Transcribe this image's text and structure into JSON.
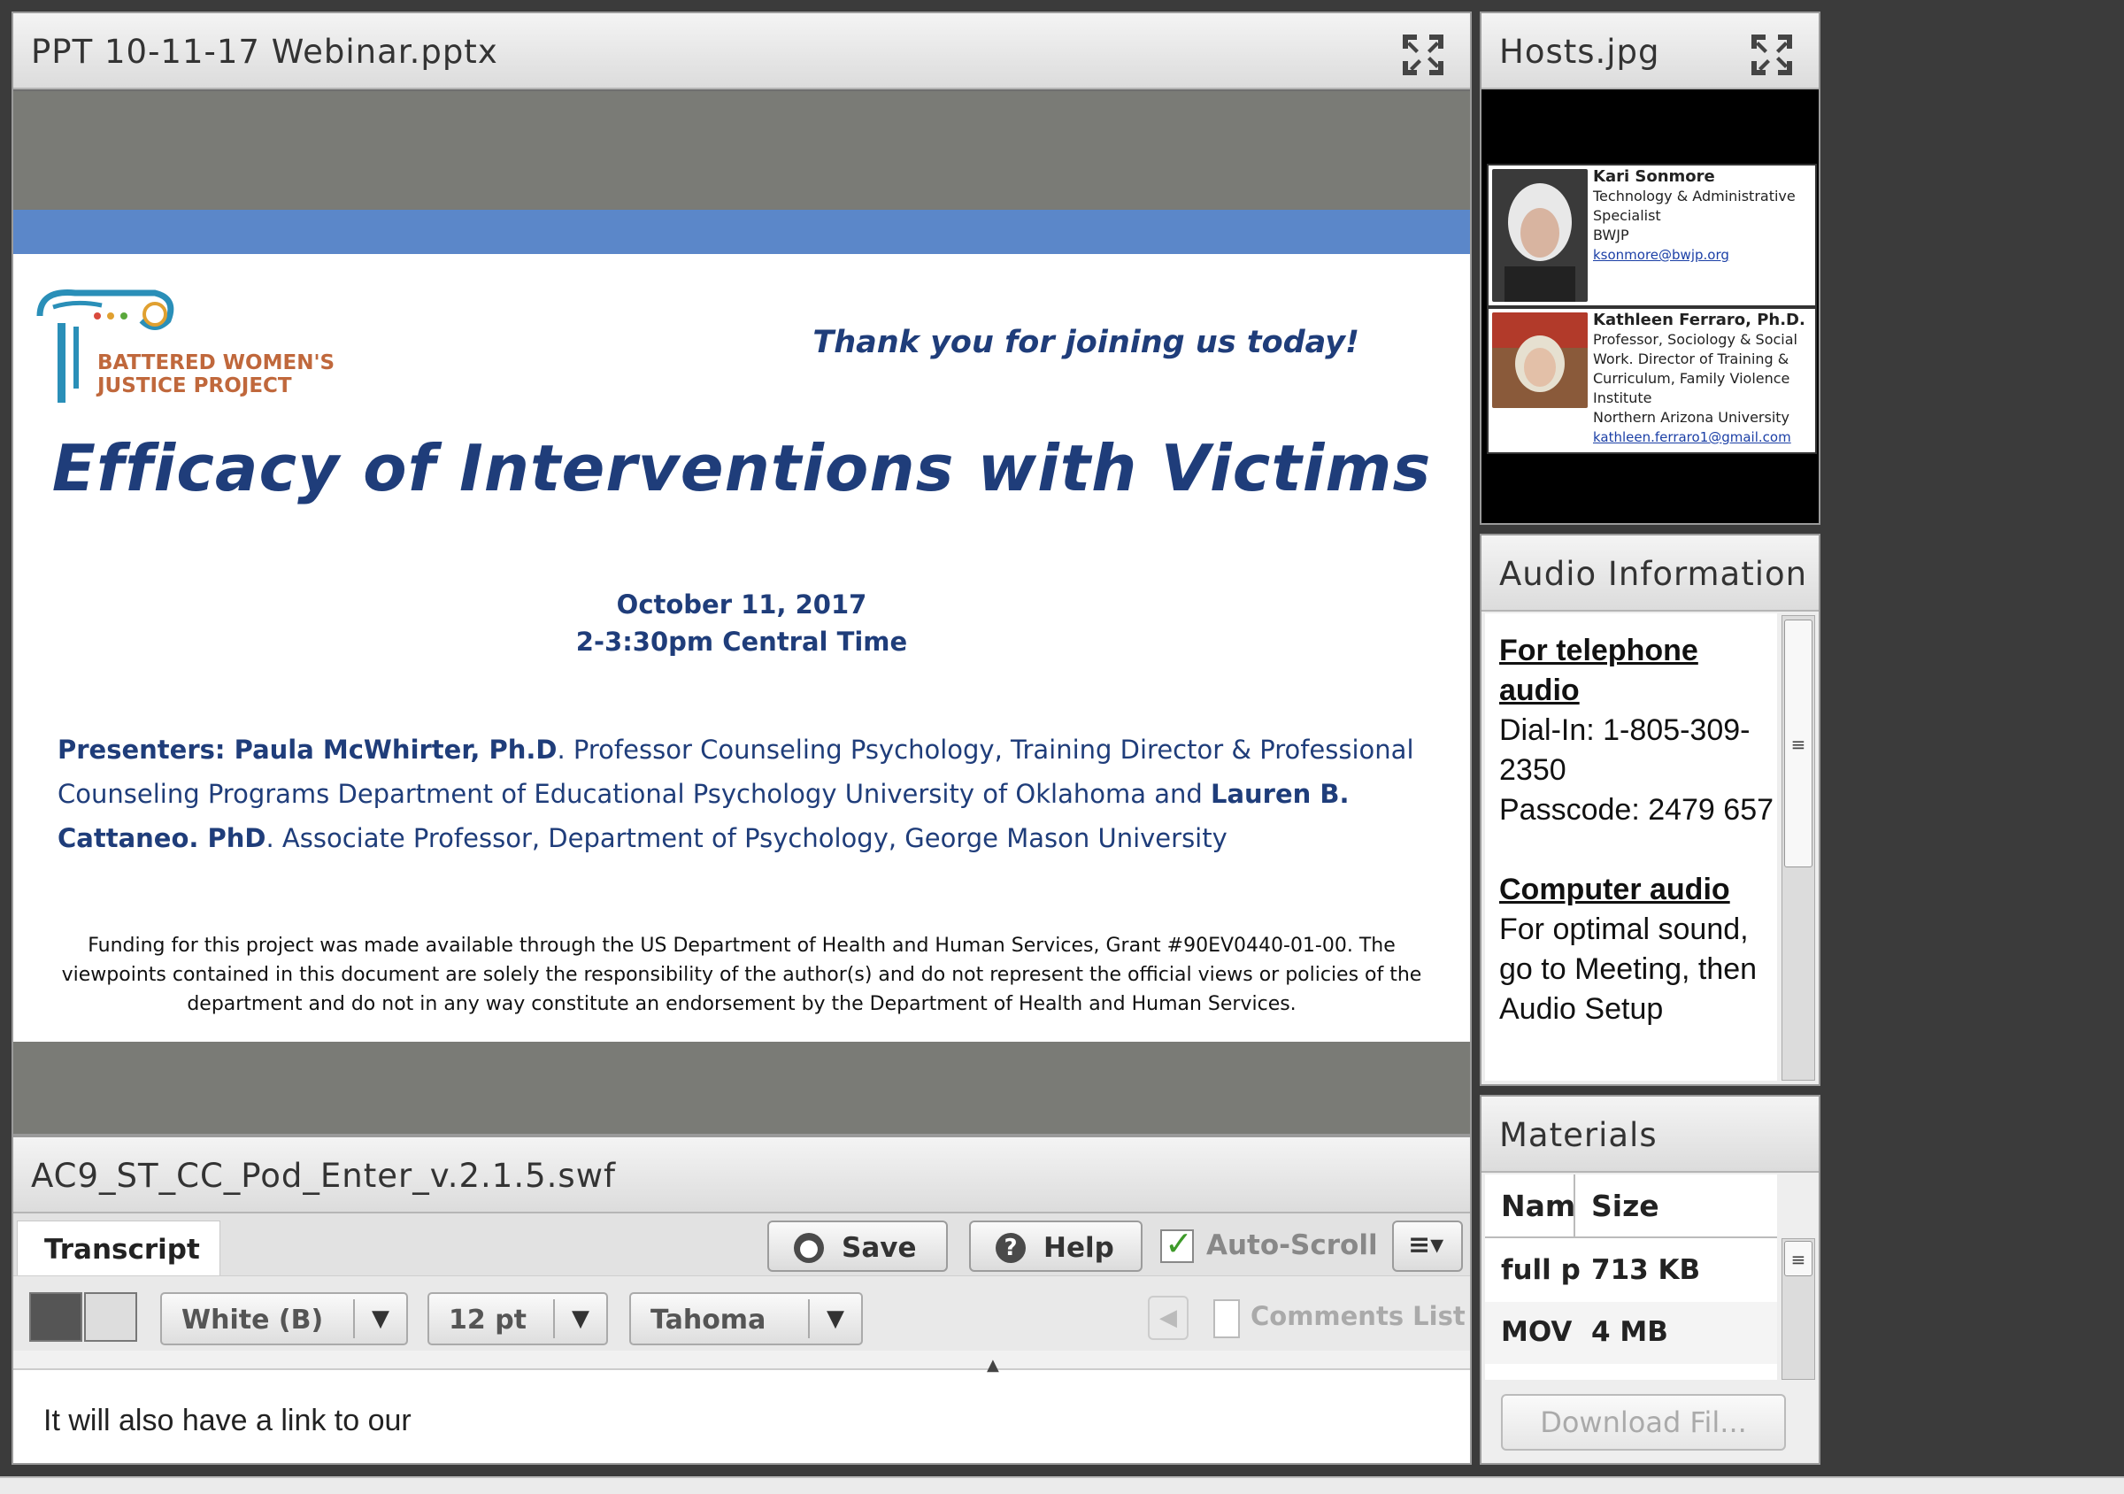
{
  "ppt_pod": {
    "title": "PPT 10-11-17 Webinar.pptx",
    "slide": {
      "logo_line1": "BATTERED WOMEN'S",
      "logo_line2": "JUSTICE PROJECT",
      "thanks": "Thank you for joining us today!",
      "title": "Efficacy of Interventions with Victims",
      "date": "October 11, 2017",
      "time": "2-3:30pm Central Time",
      "presenters_label": "Presenters: Paula McWhirter, Ph.D",
      "presenters_text1": ". Professor Counseling Psychology, Training Director & Professional Counseling Programs Department of Educational Psychology University of Oklahoma and ",
      "presenter2": "Lauren B. Cattaneo. PhD",
      "presenters_text2": ".  Associate Professor, Department of Psychology, George Mason University",
      "funding": "Funding for this project was made available through the US Department of Health and Human Services, Grant #90EV0440-01-00. The viewpoints contained in this document are solely the responsibility of the author(s) and do not represent the official views or policies of the department and do not in any way constitute an endorsement by the Department of Health and Human Services."
    }
  },
  "cc_pod": {
    "title": "AC9_ST_CC_Pod_Enter_v.2.1.5.swf",
    "tab": "Transcript",
    "save_label": "Save",
    "help_label": "Help",
    "autoscroll_label": "Auto-Scroll",
    "color_select": "White (B)",
    "size_select": "12 pt",
    "font_select": "Tahoma",
    "comments_label": "Comments List",
    "transcript_text": "It will also have a link to our"
  },
  "hosts_pod": {
    "title": "Hosts.jpg",
    "host1": {
      "name": "Kari Sonmore",
      "line1": "Technology & Administrative",
      "line2": "Specialist",
      "line3": "BWJP",
      "email": "ksonmore@bwjp.org"
    },
    "host2": {
      "name": "Kathleen Ferraro, Ph.D.",
      "line1": "Professor, Sociology & Social",
      "line2": "Work. Director of Training &",
      "line3": "Curriculum, Family Violence",
      "line4": "Institute",
      "line5": "Northern Arizona University",
      "email": "kathleen.ferraro1@gmail.com"
    }
  },
  "audio_pod": {
    "title": "Audio Information",
    "phone_heading": "For telephone audio",
    "dial_in": "Dial-In:   1-805-309-2350",
    "passcode": "Passcode:   2479 657",
    "computer_heading": "Computer audio",
    "computer_text": "For optimal sound, go to Meeting, then Audio Setup"
  },
  "materials_pod": {
    "title": "Materials",
    "columns": [
      "Nam",
      "Size"
    ],
    "rows": [
      {
        "name": "full p",
        "size": "713 KB"
      },
      {
        "name": "MOV",
        "size": "4 MB"
      }
    ],
    "download_label": "Download Fil..."
  }
}
